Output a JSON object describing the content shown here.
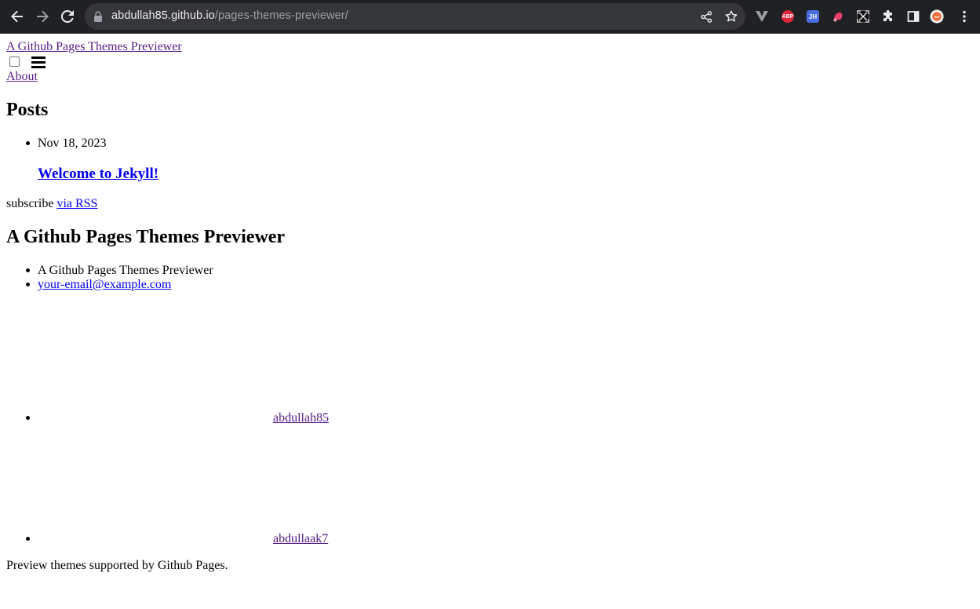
{
  "browser": {
    "url_host": "abdullah85.github.io",
    "url_path": "/pages-themes-previewer/",
    "extensions": [
      {
        "name": "abp-icon",
        "label": "ABP",
        "color": "#e0243a"
      },
      {
        "name": "jh-icon",
        "label": "JH",
        "color": "#4a6ee0"
      }
    ]
  },
  "header": {
    "site_title": "A Github Pages Themes Previewer",
    "nav_about": "About"
  },
  "posts": {
    "heading": "Posts",
    "items": [
      {
        "date": "Nov 18, 2023",
        "title": "Welcome to Jekyll!"
      }
    ],
    "subscribe_text": "subscribe",
    "subscribe_link": "via RSS"
  },
  "footer": {
    "heading": "A Github Pages Themes Previewer",
    "contact": [
      {
        "text": "A Github Pages Themes Previewer"
      },
      {
        "text": "your-email@example.com"
      }
    ],
    "social": [
      {
        "username": "abdullah85"
      },
      {
        "username": "abdullaak7"
      }
    ],
    "description": "Preview themes supported by Github Pages."
  }
}
